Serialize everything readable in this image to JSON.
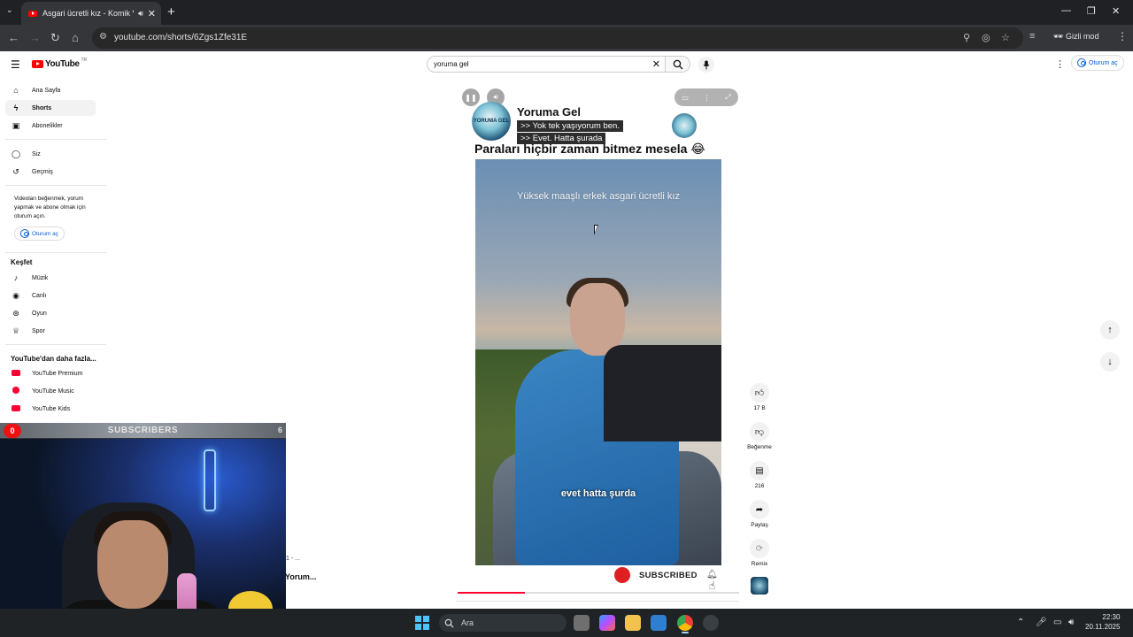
{
  "browser": {
    "tab_title": "Asgari ücretli kız - Komik V...",
    "tab_close": "✕",
    "new_tab": "+",
    "url": "youtube.com/shorts/6Zgs1Zfe31E",
    "incognito_label": "Gizli mod"
  },
  "header": {
    "logo_text": "YouTube",
    "logo_region": "TR",
    "search_value": "yoruma gel",
    "signin_label": "Oturum aç"
  },
  "sidebar": {
    "main_items": [
      {
        "label": "Ana Sayfa",
        "icon": "home-icon"
      },
      {
        "label": "Shorts",
        "icon": "shorts-icon"
      },
      {
        "label": "Abonelikler",
        "icon": "subscriptions-icon"
      }
    ],
    "you_items": [
      {
        "label": "Siz",
        "icon": "user-icon"
      },
      {
        "label": "Geçmiş",
        "icon": "history-icon"
      }
    ],
    "signin_note": "Videoları beğenmek, yorum yapmak ve abone olmak için oturum açın.",
    "signin_label": "Oturum aç",
    "explore_title": "Keşfet",
    "explore_items": [
      {
        "label": "Müzik",
        "icon": "music-icon"
      },
      {
        "label": "Canlı",
        "icon": "live-icon"
      },
      {
        "label": "Oyun",
        "icon": "gaming-icon"
      },
      {
        "label": "Spor",
        "icon": "trophy-icon"
      }
    ],
    "more_title": "YouTube'dan daha fazla...",
    "more_items": [
      {
        "label": "YouTube Premium"
      },
      {
        "label": "YouTube Music"
      },
      {
        "label": "YouTube Kids"
      }
    ]
  },
  "short": {
    "channel_name": "Yoruma Gel",
    "logo_text": "YORUMA GEL",
    "line1": ">> Yok tek yaşıyorum ben.",
    "line2": ">> Evet. Hatta şurada",
    "caption": "Paraları hiçbir zaman bitmez mesela 😂",
    "video_overlay_text": "Yüksek maaşlı erkek asgari ücretli kız",
    "video_subtitle": "evet hatta şurda",
    "subscribed_label": "SUBSCRIBED",
    "progress_fraction": 0.24
  },
  "actions": {
    "like_count": "17 B",
    "dislike_label": "Beğenme",
    "comments_count": "216",
    "share_label": "Paylaş",
    "remix_label": "Remix"
  },
  "webcam_overlay": {
    "title": "SUBSCRIBERS",
    "left_count": "0",
    "right_count": "6",
    "side_text_1": "1 - ...",
    "side_text_2": "Yorum..."
  },
  "taskbar": {
    "search_placeholder": "Ara",
    "time": "22:30",
    "date": "20.11.2025"
  },
  "colors": {
    "youtube_red": "#ff0000",
    "link_blue": "#065fd4",
    "chrome_dark": "#202124"
  }
}
